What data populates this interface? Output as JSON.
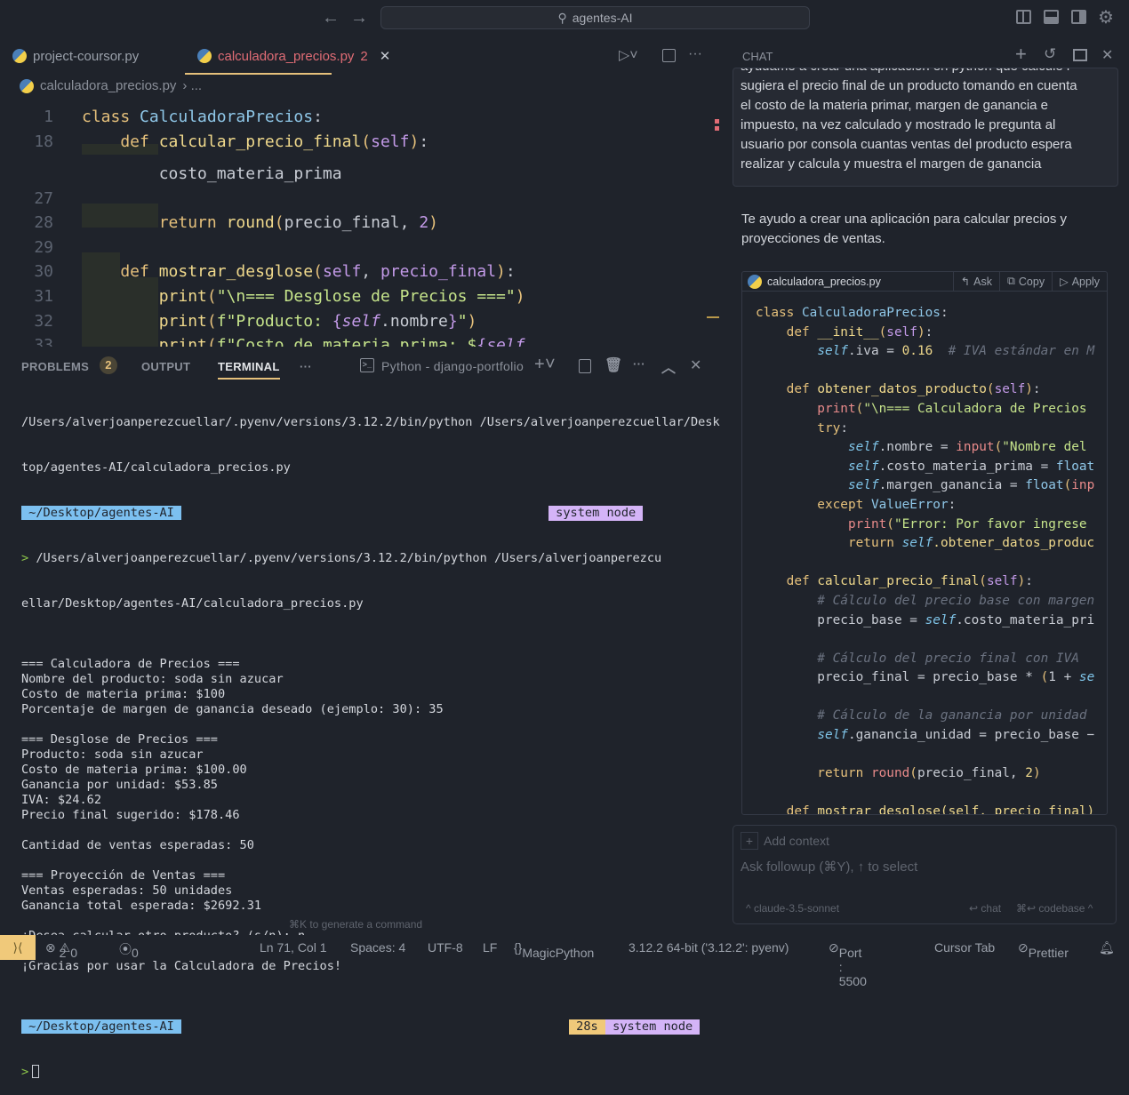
{
  "titlebar": {
    "search": "agentes-AI",
    "back": "←",
    "forward": "→"
  },
  "tabs": [
    {
      "label": "project-coursor.py"
    },
    {
      "label": "calculadora_precios.py",
      "badge": "2",
      "close": "✕"
    }
  ],
  "breadcrumb": {
    "file": "calculadora_precios.py",
    "more": "› ..."
  },
  "editor": {
    "lines": [
      {
        "n": "1",
        "t": [
          [
            "class ",
            "k"
          ],
          [
            "CalculadoraPrecios",
            "c"
          ],
          [
            ":",
            "p"
          ]
        ]
      },
      {
        "n": "18",
        "t": [
          [
            "    def ",
            "k"
          ],
          [
            "calcular_precio_final",
            "f"
          ],
          [
            "(",
            "k"
          ],
          [
            "self",
            "sf"
          ],
          [
            ")",
            "k"
          ],
          [
            ":",
            "p"
          ]
        ]
      },
      {
        "n": "",
        "t": [
          [
            "        costo_materia_prima",
            "p"
          ]
        ]
      },
      {
        "n": "27",
        "t": []
      },
      {
        "n": "28",
        "t": [
          [
            "        return ",
            "k"
          ],
          [
            "round",
            "f"
          ],
          [
            "(",
            "k"
          ],
          [
            "precio_final, ",
            "p"
          ],
          [
            "2",
            "n"
          ],
          [
            ")",
            "k"
          ]
        ]
      },
      {
        "n": "29",
        "t": []
      },
      {
        "n": "30",
        "t": [
          [
            "    def ",
            "k"
          ],
          [
            "mostrar_desglose",
            "f"
          ],
          [
            "(",
            "k"
          ],
          [
            "self",
            "sf"
          ],
          [
            ", ",
            "p"
          ],
          [
            "precio_final",
            "sf"
          ],
          [
            ")",
            "k"
          ],
          [
            ":",
            "p"
          ]
        ]
      },
      {
        "n": "31",
        "t": [
          [
            "        print",
            "f"
          ],
          [
            "(",
            "k"
          ],
          [
            "\"\\n=== Desglose de Precios ===\"",
            "s"
          ],
          [
            ")",
            "k"
          ]
        ]
      },
      {
        "n": "32",
        "t": [
          [
            "        print",
            "f"
          ],
          [
            "(",
            "k"
          ],
          [
            "f\"Producto: ",
            "s"
          ],
          [
            "{",
            "sf"
          ],
          [
            "self",
            "sf it"
          ],
          [
            ".nombre",
            "p"
          ],
          [
            "}",
            "sf"
          ],
          [
            "\"",
            "s"
          ],
          [
            ")",
            "k"
          ]
        ]
      },
      {
        "n": "33",
        "t": [
          [
            "        print",
            "f"
          ],
          [
            "(",
            "k"
          ],
          [
            "f\"Costo de materia prima: $",
            "s"
          ],
          [
            "{",
            "sf"
          ],
          [
            "self",
            "sf it"
          ],
          [
            ".",
            "p"
          ]
        ]
      }
    ]
  },
  "panel": {
    "problems": "PROBLEMS",
    "problems_count": "2",
    "output": "OUTPUT",
    "terminal": "TERMINAL",
    "more": "···",
    "terminal_name": "Python - django-portfolio"
  },
  "terminal": {
    "cmd1a": "/Users/alverjoanperezcuellar/.pyenv/versions/3.12.2/bin/python /Users/alverjoanperezcuellar/Desk",
    "cmd1b": "top/agentes-AI/calculadora_precios.py",
    "prompt_dir": " ~/Desktop/agentes-AI ",
    "prompt_node": " system node ",
    "prompt_time": " 28s ",
    "arrow": ">",
    "cmd2a": " /Users/alverjoanperezcuellar/.pyenv/versions/3.12.2/bin/python /Users/alverjoanperezcu",
    "cmd2b": "ellar/Desktop/agentes-AI/calculadora_precios.py",
    "output": [
      "",
      "=== Calculadora de Precios ===",
      "Nombre del producto: soda sin azucar",
      "Costo de materia prima: $100",
      "Porcentaje de margen de ganancia deseado (ejemplo: 30): 35",
      "",
      "=== Desglose de Precios ===",
      "Producto: soda sin azucar",
      "Costo de materia prima: $100.00",
      "Ganancia por unidad: $53.85",
      "IVA: $24.62",
      "Precio final sugerido: $178.46",
      "",
      "Cantidad de ventas esperadas: 50",
      "",
      "=== Proyección de Ventas ===",
      "Ventas esperadas: 50 unidades",
      "Ganancia total esperada: $2692.31",
      "",
      "¿Desea calcular otro producto? (s/n): n",
      "",
      "¡Gracias por usar la Calculadora de Precios!",
      ""
    ]
  },
  "hint": "⌘K to generate a command",
  "status": {
    "errors": "2",
    "warnings": "0",
    "ports": "0",
    "position": "Ln 71, Col 1",
    "spaces": "Spaces: 4",
    "encoding": "UTF-8",
    "eol": "LF",
    "language": "MagicPython",
    "interpreter": "3.12.2 64-bit ('3.12.2': pyenv)",
    "port": "Port : 5500",
    "cursor_tab": "Cursor Tab",
    "prettier": "Prettier"
  },
  "chat": {
    "title": "CHAT",
    "user_message": [
      "ayúdame a crear una aplicación en python que calcule l",
      "sugiera el precio final de un producto tomando en cuenta",
      "el costo de la materia primar, margen de ganancia e",
      "impuesto, na vez calculado y mostrado le pregunta al",
      "usuario por consola cuantas ventas del producto espera",
      "realizar y calcula y muestra el margen de ganancia"
    ],
    "response": "Te ayudo a crear una aplicación para calcular precios y proyecciones de ventas.",
    "code_file": "calculadora_precios.py",
    "ask": "Ask",
    "copy": "Copy",
    "apply": "Apply",
    "code": [
      [
        [
          "class ",
          "k"
        ],
        [
          "CalculadoraPrecios",
          "c"
        ],
        [
          ":",
          "p"
        ]
      ],
      [
        [
          "    def ",
          "k"
        ],
        [
          "__init__",
          "f"
        ],
        [
          "(",
          "k"
        ],
        [
          "self",
          "sf"
        ],
        [
          ")",
          "k"
        ],
        [
          ":",
          "p"
        ]
      ],
      [
        [
          "        ",
          "p"
        ],
        [
          "self",
          "slf"
        ],
        [
          ".iva = ",
          "p"
        ],
        [
          "0.16",
          "f"
        ],
        [
          "  # IVA estándar en M",
          "cm"
        ]
      ],
      [],
      [
        [
          "    def ",
          "k"
        ],
        [
          "obtener_datos_producto",
          "f"
        ],
        [
          "(",
          "k"
        ],
        [
          "self",
          "sf"
        ],
        [
          ")",
          "k"
        ],
        [
          ":",
          "p"
        ]
      ],
      [
        [
          "        print",
          "pr"
        ],
        [
          "(",
          "k"
        ],
        [
          "\"\\n=== Calculadora de Precios",
          "s"
        ]
      ],
      [
        [
          "        try",
          "k"
        ],
        [
          ":",
          "p"
        ]
      ],
      [
        [
          "            ",
          "p"
        ],
        [
          "self",
          "slf"
        ],
        [
          ".nombre = ",
          "p"
        ],
        [
          "input",
          "pr"
        ],
        [
          "(",
          "k"
        ],
        [
          "\"Nombre del",
          "s"
        ]
      ],
      [
        [
          "            ",
          "p"
        ],
        [
          "self",
          "slf"
        ],
        [
          ".costo_materia_prima = ",
          "p"
        ],
        [
          "float",
          "c"
        ]
      ],
      [
        [
          "            ",
          "p"
        ],
        [
          "self",
          "slf"
        ],
        [
          ".margen_ganancia = ",
          "p"
        ],
        [
          "float",
          "c"
        ],
        [
          "(",
          "k"
        ],
        [
          "inp",
          "pr"
        ]
      ],
      [
        [
          "        except ",
          "k"
        ],
        [
          "ValueError",
          "c"
        ],
        [
          ":",
          "p"
        ]
      ],
      [
        [
          "            print",
          "pr"
        ],
        [
          "(",
          "k"
        ],
        [
          "\"Error: Por favor ingrese",
          "s"
        ]
      ],
      [
        [
          "            return ",
          "k"
        ],
        [
          "self",
          "slf"
        ],
        [
          ".obtener_datos_produc",
          "f"
        ]
      ],
      [],
      [
        [
          "    def ",
          "k"
        ],
        [
          "calcular_precio_final",
          "f"
        ],
        [
          "(",
          "k"
        ],
        [
          "self",
          "sf"
        ],
        [
          ")",
          "k"
        ],
        [
          ":",
          "p"
        ]
      ],
      [
        [
          "        # Cálculo del precio base con margen",
          "cm"
        ]
      ],
      [
        [
          "        precio_base = ",
          "p"
        ],
        [
          "self",
          "slf"
        ],
        [
          ".costo_materia_pri",
          "p"
        ]
      ],
      [],
      [
        [
          "        # Cálculo del precio final con IVA",
          "cm"
        ]
      ],
      [
        [
          "        precio_final = precio_base * ",
          "p"
        ],
        [
          "(",
          "k"
        ],
        [
          "1 + ",
          "p"
        ],
        [
          "se",
          "slf"
        ]
      ],
      [],
      [
        [
          "        # Cálculo de la ganancia por unidad",
          "cm"
        ]
      ],
      [
        [
          "        ",
          "p"
        ],
        [
          "self",
          "slf"
        ],
        [
          ".ganancia_unidad = precio_base −",
          "p"
        ]
      ],
      [],
      [
        [
          "        return ",
          "k"
        ],
        [
          "round",
          "pr"
        ],
        [
          "(",
          "k"
        ],
        [
          "precio_final, ",
          "p"
        ],
        [
          "2",
          "f"
        ],
        [
          ")",
          "k"
        ]
      ],
      [],
      [
        [
          "    def ",
          "k"
        ],
        [
          "mostrar_desglose(self, precio_final)",
          "f"
        ]
      ]
    ],
    "add_context": "Add context",
    "placeholder": "Ask followup (⌘Y), ↑ to select",
    "model": "claude-3.5-sonnet",
    "send_chat": "chat",
    "send_codebase": "codebase"
  }
}
